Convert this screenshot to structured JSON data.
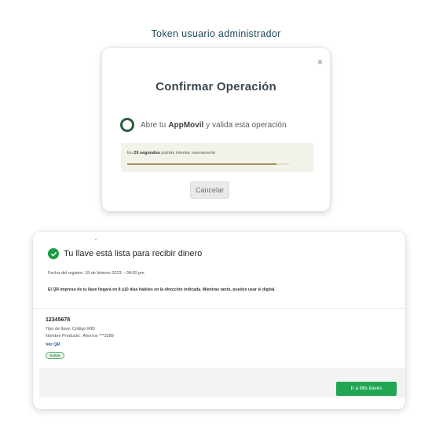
{
  "page": {
    "title": "Token usuario administrador"
  },
  "modal": {
    "close_glyph": "×",
    "title": "Confirmar Operación",
    "prompt_prefix": "Abre tu",
    "prompt_app": "AppMovil",
    "prompt_suffix": "y valida esta operación",
    "timer_prefix": "En",
    "timer_seconds": "29 segundos",
    "timer_suffix": "podrás intentar nuevamente",
    "timer_progress": 0.92,
    "cancel_label": "Cancelar",
    "colors": {
      "ring": "#2f5c3a",
      "progress": "#a6915a"
    }
  },
  "key_card": {
    "title": "Tu llave está lista para recibir dinero",
    "registration_date": "Fecha del registro: 18 de febrero  2023 – 08:00 pm",
    "info": "El QR impreso de tu llave llegará en 8 a10 días hábiles en la dirección indicada. Mientras tanto, puedes usar el digital.",
    "key_number": "12345678",
    "key_type": "Tipo de llave: Código MID",
    "product": "Nombre Producto:: Ahorros ***3289",
    "view_qr_label": "Ver QR",
    "status": "Activa",
    "action_label": "Ir a Mis llaves",
    "colors": {
      "check": "#1c9a45",
      "action": "#22a653",
      "link": "#1a53a6"
    }
  },
  "icons": [
    "close-icon",
    "ring-icon",
    "check-circle-icon"
  ]
}
